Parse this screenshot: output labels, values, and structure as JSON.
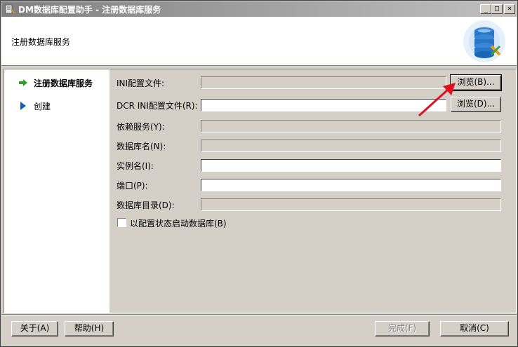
{
  "window": {
    "title": "DM数据库配置助手 - 注册数据库服务",
    "controls": {
      "minimize": "_",
      "maximize": "□",
      "close": "×"
    }
  },
  "banner": {
    "heading": "注册数据库服务"
  },
  "sidebar": {
    "steps": [
      {
        "label": "注册数据库服务",
        "active": true
      },
      {
        "label": "创建",
        "active": false
      }
    ]
  },
  "form": {
    "ini_file": {
      "label": "INI配置文件:",
      "value": ""
    },
    "dcr_ini_file": {
      "label": "DCR INI配置文件(R):",
      "value": ""
    },
    "depend_service": {
      "label": "依赖服务(Y):",
      "value": ""
    },
    "db_name": {
      "label": "数据库名(N):",
      "value": ""
    },
    "instance_name": {
      "label": "实例名(I):",
      "value": ""
    },
    "port": {
      "label": "端口(P):",
      "value": ""
    },
    "db_dir": {
      "label": "数据库目录(D):",
      "value": ""
    },
    "browse_ini": "浏览(B)...",
    "browse_dcr": "浏览(D)...",
    "start_with_config": {
      "label": "以配置状态启动数据库(B)",
      "checked": false
    }
  },
  "footer": {
    "about": "关于(A)",
    "help": "帮助(H)",
    "finish": "完成(F)",
    "cancel": "取消(C)"
  },
  "colors": {
    "accent_arrow": "#e01020",
    "step_arrow_active": "#2aa02a",
    "step_arrow": "#1060c0"
  }
}
